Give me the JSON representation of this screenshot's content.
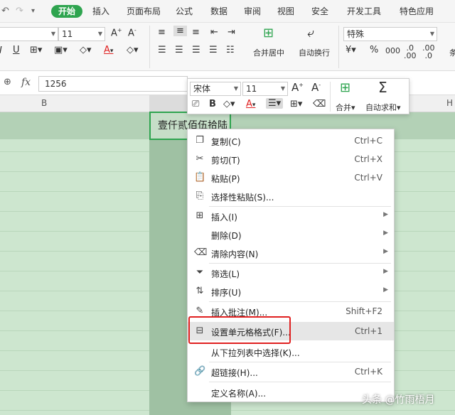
{
  "ribbon_tabs": [
    "开始",
    "插入",
    "页面布局",
    "公式",
    "数据",
    "审阅",
    "视图",
    "安全",
    "开发工具",
    "特色应用"
  ],
  "colors": {
    "accent": "#2ea44f",
    "highlight_box": "#e02020",
    "grid_bg": "#cde6cf"
  },
  "ribbon": {
    "font_size": "11",
    "number_format": "特殊",
    "merge_center_label": "合并居中",
    "wrap_text_label": "自动换行",
    "percent_symbol": "%",
    "decimals_increase": ".00→.0",
    "edge_text": "条"
  },
  "formula_bar": {
    "fx_label": "fx",
    "value": "1256"
  },
  "grid": {
    "col_b_label": "B",
    "col_h_label": "H",
    "selected_cell_text": "壹仟贰佰伍拾陆"
  },
  "mini_toolbar": {
    "font_name": "宋体",
    "font_size": "11",
    "merge_label": "合并",
    "autosum_label": "自动求和"
  },
  "context_menu": {
    "items": [
      {
        "icon": "copy-icon",
        "label": "复制(C)",
        "shortcut": "Ctrl+C"
      },
      {
        "icon": "scissors-icon",
        "label": "剪切(T)",
        "shortcut": "Ctrl+X"
      },
      {
        "icon": "paste-icon",
        "label": "粘贴(P)",
        "shortcut": "Ctrl+V"
      },
      {
        "icon": "paste-special-icon",
        "label": "选择性粘贴(S)...",
        "shortcut": ""
      },
      {
        "icon": "insert-icon",
        "label": "插入(I)",
        "shortcut": ""
      },
      {
        "icon": "",
        "label": "删除(D)",
        "shortcut": ""
      },
      {
        "icon": "eraser-icon",
        "label": "清除内容(N)",
        "shortcut": ""
      },
      {
        "icon": "filter-icon",
        "label": "筛选(L)",
        "shortcut": ""
      },
      {
        "icon": "sort-icon",
        "label": "排序(U)",
        "shortcut": ""
      },
      {
        "icon": "comment-icon",
        "label": "插入批注(M)...",
        "shortcut": "Shift+F2"
      },
      {
        "icon": "format-cells-icon",
        "label": "设置单元格格式(F)...",
        "shortcut": "Ctrl+1"
      },
      {
        "icon": "",
        "label": "从下拉列表中选择(K)...",
        "shortcut": ""
      },
      {
        "icon": "link-icon",
        "label": "超链接(H)...",
        "shortcut": "Ctrl+K"
      },
      {
        "icon": "",
        "label": "定义名称(A)...",
        "shortcut": ""
      }
    ]
  },
  "watermark": "头条 @竹雨梧月"
}
